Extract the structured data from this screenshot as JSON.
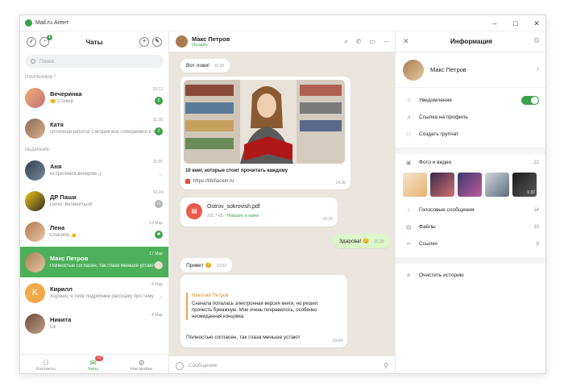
{
  "titlebar": {
    "app_title": "Mail.ru Агент",
    "minimize": "–",
    "maximize": "□",
    "close": "✕"
  },
  "left": {
    "title": "Чаты",
    "contacts_badge": "1",
    "search_placeholder": "Поиск",
    "favorites_label": "ИЗБРАННЫЕ ^",
    "recent_label": "НЕДАВНИЕ",
    "favorites": [
      {
        "name": "Вечеринка",
        "preview": "😊 Стикер",
        "time": "10:12",
        "unread": "6"
      },
      {
        "name": "Катя",
        "preview": "Отличная работа! Сегодня все собираемся в ТЦ",
        "time": "11:28",
        "unread": "2"
      }
    ],
    "recent": [
      {
        "name": "Аня",
        "preview": "Встретимся вечером :)",
        "time": "11:05",
        "unread": ""
      },
      {
        "name": "ДР Паши",
        "preview": "Denis: Вклиниться!",
        "time": "10:24",
        "unread": ""
      },
      {
        "name": "Лена",
        "preview": "Спасибо 👍",
        "time": "13 Мар",
        "unread": ""
      },
      {
        "name": "Макс Петров",
        "preview": "Полностью согласен, так глаза меньше устают",
        "time": "17 Мар",
        "unread": ""
      },
      {
        "name": "Кирилл",
        "preview": "Хорошо, я тебе подробнее расскажу про тему",
        "time": "4 Мар",
        "unread": ""
      },
      {
        "name": "Никита",
        "preview": "Ок",
        "time": "4 Мар",
        "unread": ""
      }
    ],
    "footer": {
      "contacts": "Контакты",
      "chats": "Чаты",
      "chats_badge": "12",
      "settings": "Настройки"
    }
  },
  "middle": {
    "contact_name": "Макс Петров",
    "contact_status": "Онлайн",
    "messages": {
      "m1_text": "Вот лови!",
      "m1_time": "10:02",
      "link_title": "10 книг, которые стоит прочитать каждому",
      "link_url": "https://lifehacker.ru",
      "link_time": "14:35",
      "file_name": "Ostrov_sokrovish.pdf",
      "file_size": "202.7 КБ",
      "file_action": "Показать в папке",
      "file_time": "16:20",
      "out_text": "Здарова!",
      "out_emoji": "😊",
      "out_time": "15:26",
      "m3_text": "Привет 😊",
      "m3_time": "19:02",
      "quote_author": "Николай Петров",
      "quote_text": "Сначала попалась электронная версия книги, но решил прочесть бумажную. Мне очень понравилось, особенно неожиданная концовка",
      "reply_text": "Полностью согласен, так глаза меньше устают",
      "reply_time": "19:04"
    },
    "composer_placeholder": "Сообщение"
  },
  "right": {
    "title": "Информация",
    "profile_name": "Макс Петров",
    "notifications": "Уведомления",
    "profile_link": "Ссылка на профиль",
    "create_group": "Создать групчат",
    "photos_label": "Фото и видео",
    "photos_count": "22",
    "video_time": "1:37",
    "voice_label": "Голосовые сообщения",
    "voice_count": "14",
    "files_label": "Файлы",
    "files_count": "10",
    "links_label": "Ссылки",
    "links_count": "8",
    "clear_history": "Очистить историю"
  },
  "colors": {
    "accent": "#3aa34a",
    "chat_bg": "#eae6df",
    "outgoing_bubble": "#dcf5c9",
    "active_row": "#4db05a"
  }
}
